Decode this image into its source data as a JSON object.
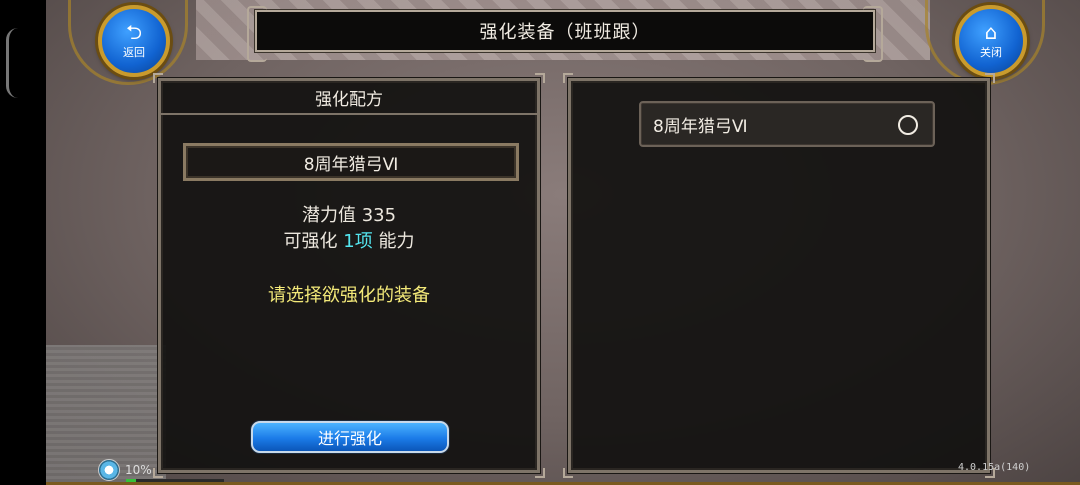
{
  "window": {
    "title": "强化装备（班班跟）"
  },
  "nav": {
    "back_label": "返回",
    "close_label": "关闭",
    "back_icon": "return-arrow-icon",
    "close_icon": "home-icon"
  },
  "left_panel": {
    "header": "强化配方",
    "selected_item": "8周年猎弓Ⅵ",
    "potential_label": "潜力值",
    "potential_value": "335",
    "enhanceable_prefix": "可强化",
    "enhanceable_count": "1项",
    "enhanceable_suffix": "能力",
    "hint": "请选择欲强化的装备",
    "action_button": "进行强化"
  },
  "right_panel": {
    "items": [
      {
        "label": "8周年猎弓Ⅵ",
        "selected": false
      }
    ]
  },
  "status": {
    "load_percent": "10%",
    "load_fraction": 0.1,
    "version": "4.0.15a(140)"
  },
  "colors": {
    "highlight_cyan": "#54e6f0",
    "hint_yellow": "#f3e979",
    "button_blue": "#1b7be8",
    "frame_gold": "#c99b2d"
  }
}
